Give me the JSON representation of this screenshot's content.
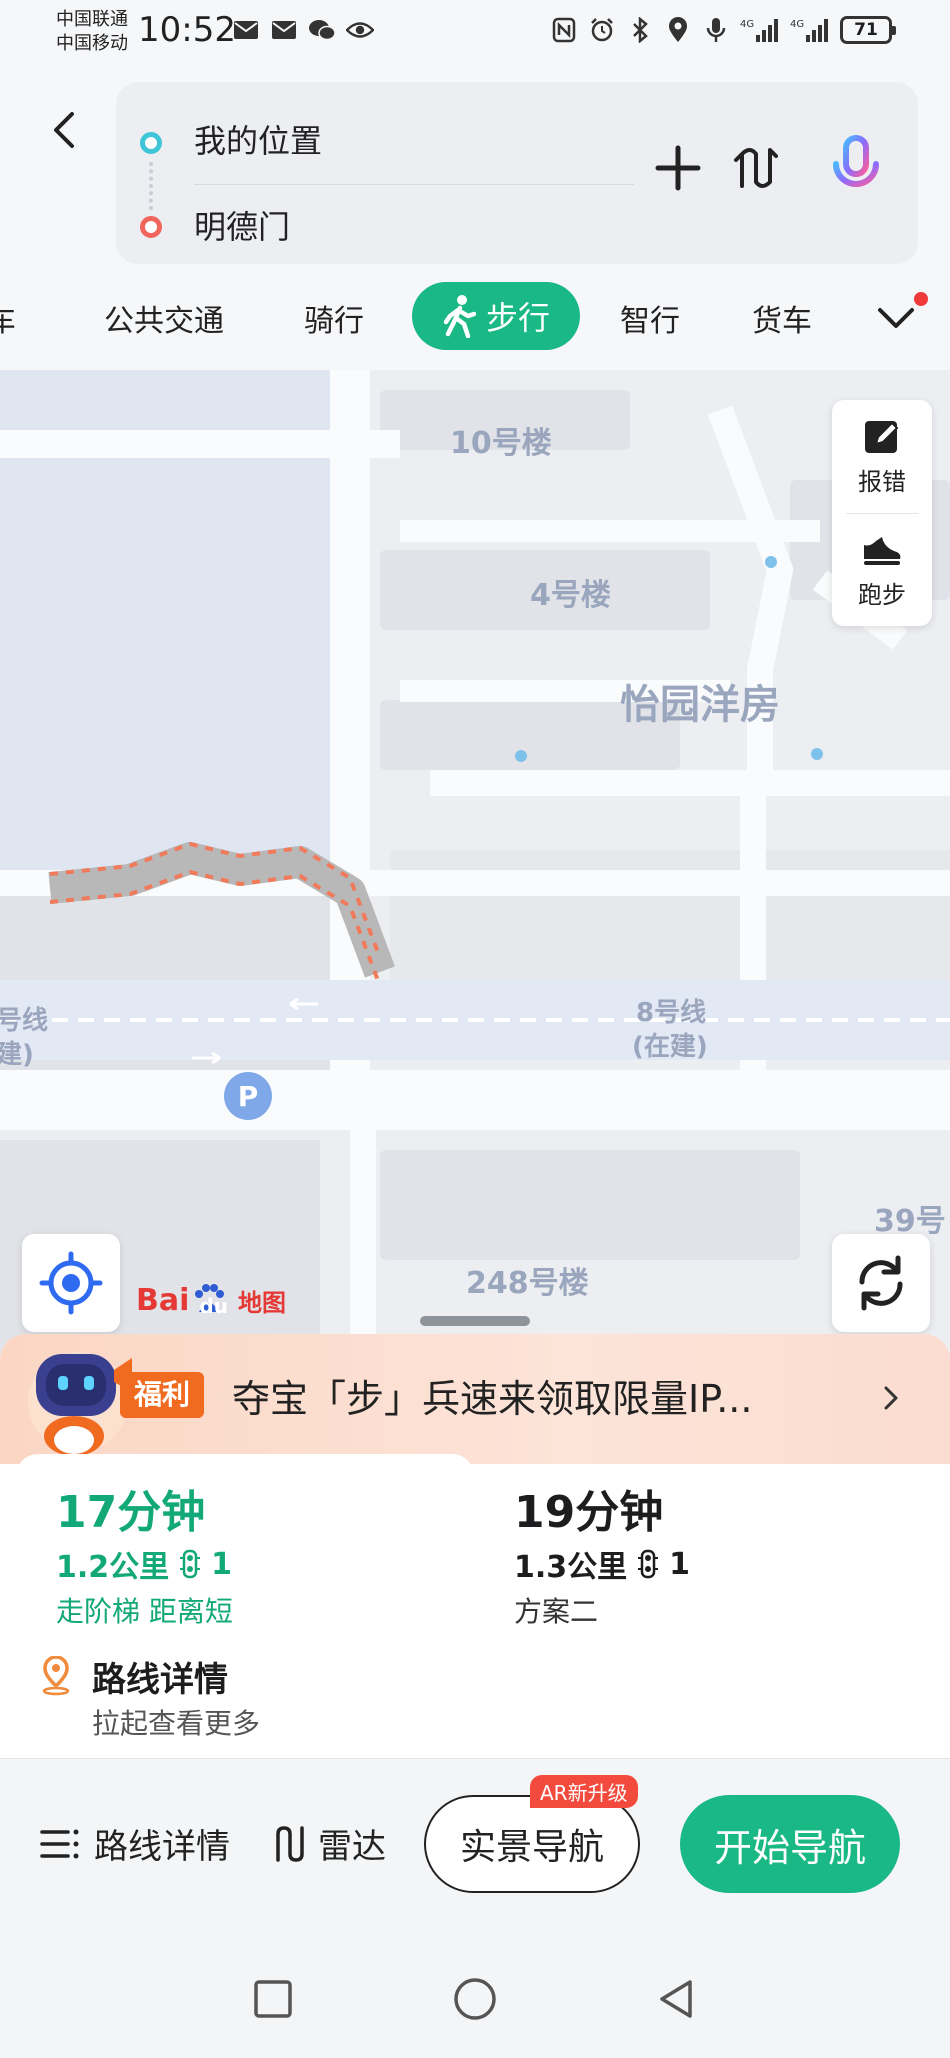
{
  "status_bar": {
    "carrier_1": "中国联通",
    "carrier_2": "中国移动",
    "time": "10:52",
    "battery": "71",
    "network_1": "4G",
    "network_2": "4G",
    "left_icons": [
      "mail-icon",
      "mail-icon",
      "wechat-icon",
      "eye-icon"
    ],
    "right_icons": [
      "nfc-icon",
      "alarm-icon",
      "bluetooth-icon",
      "location-icon",
      "mic-icon",
      "signal-icon",
      "signal-icon"
    ]
  },
  "route": {
    "origin": "我的位置",
    "destination": "明德门"
  },
  "tabs": {
    "items": [
      "车",
      "公共交通",
      "骑行",
      "步行",
      "智行",
      "货车"
    ],
    "active": "步行"
  },
  "map": {
    "labels": [
      "10号楼",
      "4号楼",
      "怡园洋房",
      "8号线",
      "(在建)",
      "248号楼",
      "39号",
      "号线",
      "建)"
    ],
    "tools": {
      "report": "报错",
      "run": "跑步"
    },
    "logo_text": "Bai",
    "logo_du": "du",
    "logo_suffix": "地图",
    "route_color": "#b8b8b8",
    "route_dash_color": "#f07a5a"
  },
  "promo": {
    "badge": "福利",
    "text": "夺宝「步」兵速来领取限量IP..."
  },
  "plans": [
    {
      "time": "17分钟",
      "distance": "1.2公里",
      "lights": "1",
      "note": "走阶梯 距离短"
    },
    {
      "time": "19分钟",
      "distance": "1.3公里",
      "lights": "1",
      "note": "方案二"
    }
  ],
  "detail": {
    "title": "路线详情",
    "subtitle": "拉起查看更多"
  },
  "actions": {
    "detail": "路线详情",
    "radar": "雷达",
    "ar_nav": "实景导航",
    "ar_badge": "AR新升级",
    "start": "开始导航"
  },
  "colors": {
    "accent": "#1ab885",
    "promo_badge": "#f06a20"
  }
}
